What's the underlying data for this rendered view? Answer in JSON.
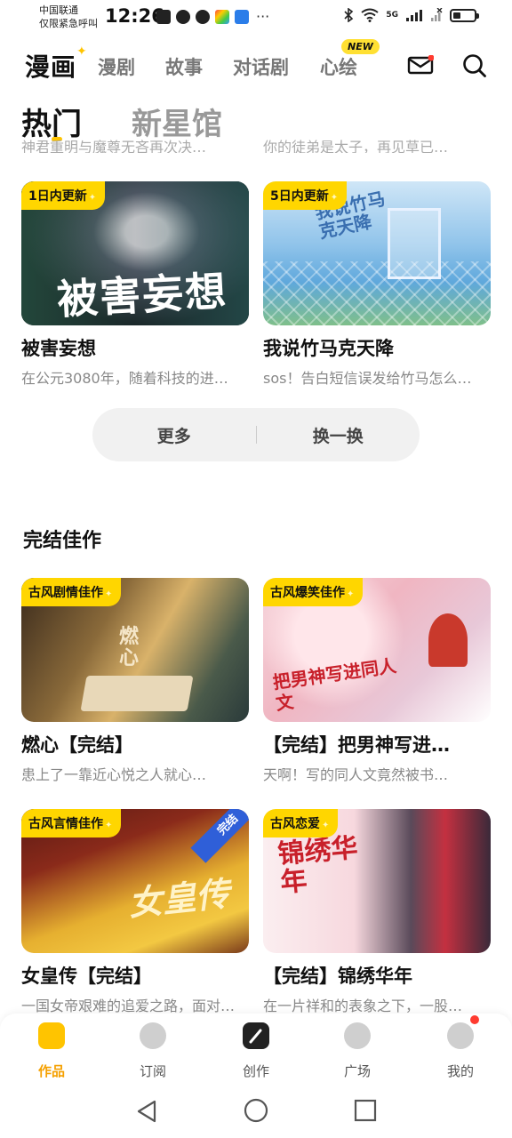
{
  "status_bar": {
    "carrier_line1": "中国联通",
    "carrier_line2": "仅限紧急呼叫",
    "time": "12:26",
    "dots": "···",
    "signal_text": "5G",
    "battery_level": 0.3
  },
  "top_nav": {
    "logo": "漫画",
    "tabs": [
      "漫剧",
      "故事",
      "对话剧",
      "心绘"
    ],
    "new_badge": "NEW",
    "mail_has_notification": true
  },
  "section_tabs": {
    "active": "热门",
    "inactive": "新星馆"
  },
  "faded_texts": [
    "神君重明与魔尊无吝再次决…",
    "你的徒弟是太子，再见草已…"
  ],
  "hot_cards": [
    {
      "tag": "1日内更新",
      "art_title": "被害妄想",
      "title": "被害妄想",
      "desc": "在公元3080年，随着科技的进…"
    },
    {
      "tag": "5日内更新",
      "art_title": "我说竹马克天降",
      "title": "我说竹马克天降",
      "desc": "sos！告白短信误发给竹马怎么…"
    }
  ],
  "pill": {
    "more": "更多",
    "refresh": "换一换"
  },
  "finished_section": {
    "title": "完结佳作",
    "cards": [
      {
        "tag": "古风剧情佳作",
        "art_title": "燃心",
        "title": "燃心【完结】",
        "desc": "患上了一靠近心悦之人就心…"
      },
      {
        "tag": "古风爆笑佳作",
        "art_title": "把男神写进同人文",
        "title": "【完结】把男神写进…",
        "desc": "天啊！写的同人文竟然被书…"
      },
      {
        "tag": "古风言情佳作",
        "ribbon": "完结",
        "art_title": "女皇传",
        "title": "女皇传【完结】",
        "desc": "一国女帝艰难的追爱之路，面对…"
      },
      {
        "tag": "古风恋爱",
        "art_title": "锦绣华年",
        "title": "【完结】锦绣华年",
        "desc": "在一片祥和的表象之下，一股…"
      }
    ]
  },
  "bottom_tabs": [
    {
      "label": "作品",
      "active": true
    },
    {
      "label": "订阅",
      "active": false
    },
    {
      "label": "创作",
      "active": false
    },
    {
      "label": "广场",
      "active": false
    },
    {
      "label": "我的",
      "active": false,
      "has_notification": true
    }
  ],
  "colors": {
    "accent": "#ffc400",
    "tag_yellow": "#ffd600",
    "active_tab_text": "#f5a000",
    "ribbon_blue": "#2f5fd8",
    "notification_red": "#ff3b30"
  }
}
